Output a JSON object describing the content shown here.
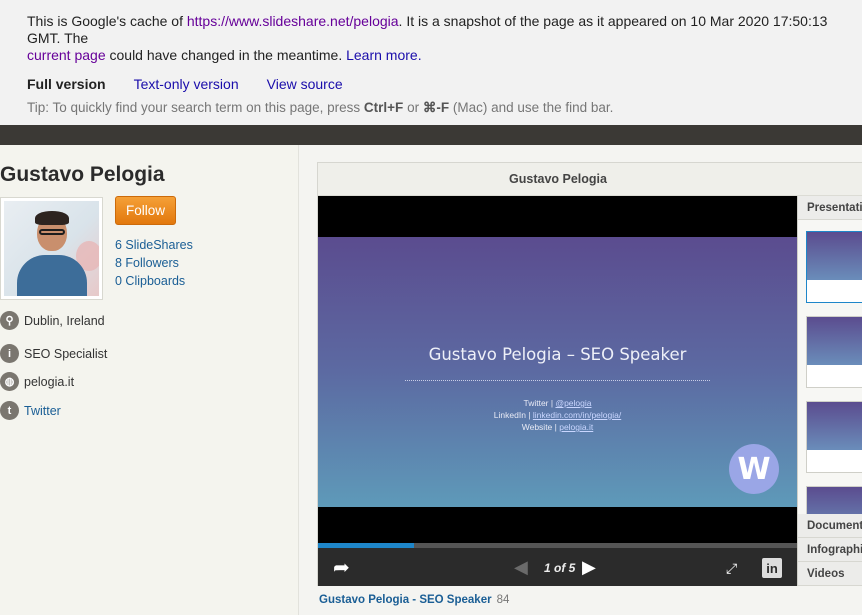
{
  "cache_banner": {
    "text_before_url": "This is Google's cache of ",
    "url": "https://www.slideshare.net/pelogia",
    "text_after_url": ". It is a snapshot of the page as it appeared on 10 Mar 2020 17:50:13 GMT. The",
    "current_page_link": "current page",
    "text_after_current": " could have changed in the meantime. ",
    "learn_more": "Learn more.",
    "nav": {
      "full": "Full version",
      "text_only": "Text-only version",
      "view_source": "View source"
    },
    "tip_prefix": "Tip: To quickly find your search term on this page, press ",
    "tip_key1": "Ctrl+F",
    "tip_or": " or ",
    "tip_key2": "⌘-F",
    "tip_suffix": " (Mac) and use the find bar."
  },
  "profile": {
    "name": "Gustavo Pelogia",
    "follow_label": "Follow",
    "stats": [
      "6 SlideShares",
      "8 Followers",
      "0 Clipboards"
    ],
    "location": "Dublin, Ireland",
    "occupation": "SEO Specialist",
    "website": "pelogia.it",
    "twitter": "Twitter"
  },
  "player": {
    "header_title": "Gustavo Pelogia",
    "slide": {
      "title": "Gustavo Pelogia – SEO Speaker",
      "twitter_label": "Twitter | ",
      "twitter_value": "@pelogia",
      "linkedin_label": "LinkedIn | ",
      "linkedin_value": "linkedin.com/in/pelogia/",
      "website_label": "Website | ",
      "website_value": "pelogia.it",
      "logo_letter": "W"
    },
    "pager": "1 of 5",
    "progress_fraction": 0.2,
    "sidebar": {
      "presentations": "Presentations",
      "documents": "Documents",
      "infographics": "Infographics",
      "videos": "Videos"
    }
  },
  "below_player": {
    "title": "Gustavo Pelogia - SEO Speaker",
    "count": "84"
  },
  "colors": {
    "accent_link": "#1a5e95",
    "follow_orange": "#e2780d",
    "progress_blue": "#1e86c9"
  }
}
